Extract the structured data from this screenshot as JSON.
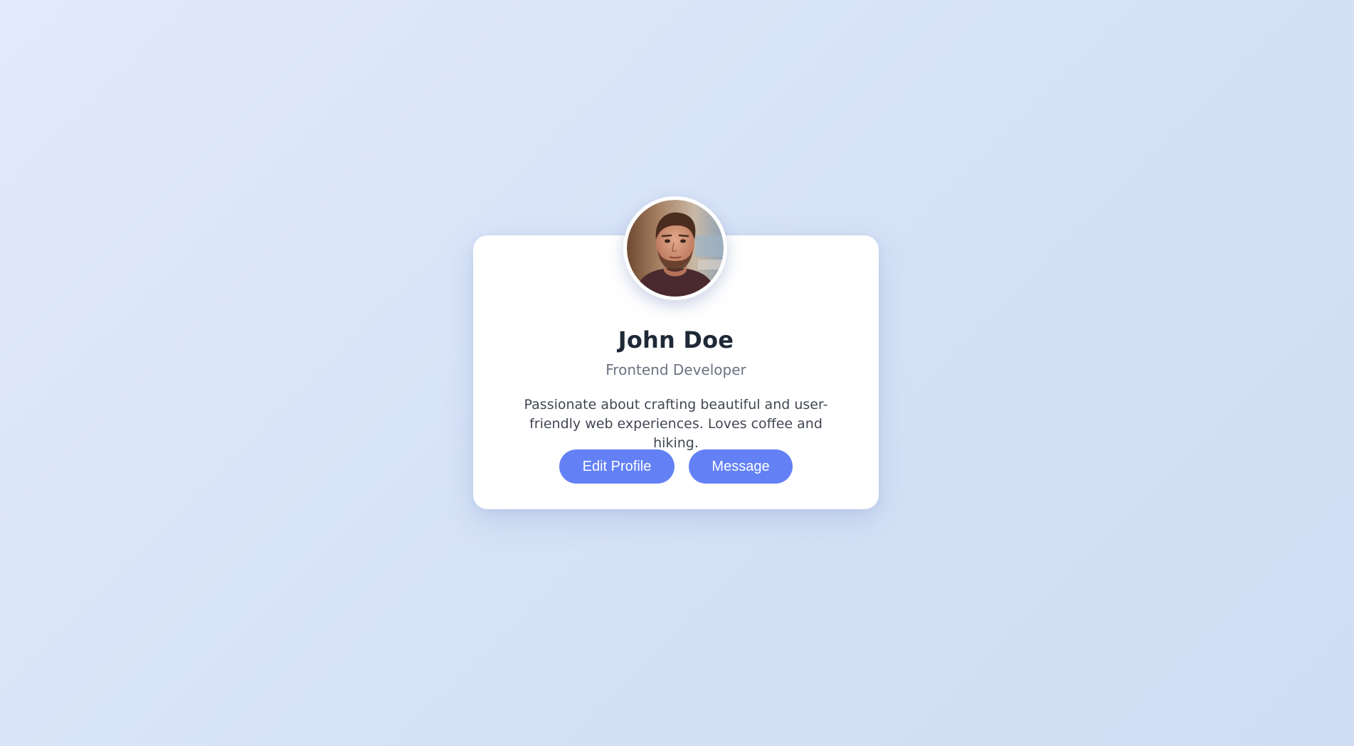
{
  "profile": {
    "name": "John Doe",
    "role": "Frontend Developer",
    "bio": "Passionate about crafting beautiful and user-friendly web experiences. Loves coffee and hiking.",
    "avatar_alt": "profile-photo"
  },
  "actions": {
    "edit_label": "Edit Profile",
    "message_label": "Message"
  },
  "colors": {
    "accent": "#6381f5",
    "name": "#1f2937",
    "role": "#6b7280",
    "bio": "#404651",
    "card": "#ffffff"
  }
}
